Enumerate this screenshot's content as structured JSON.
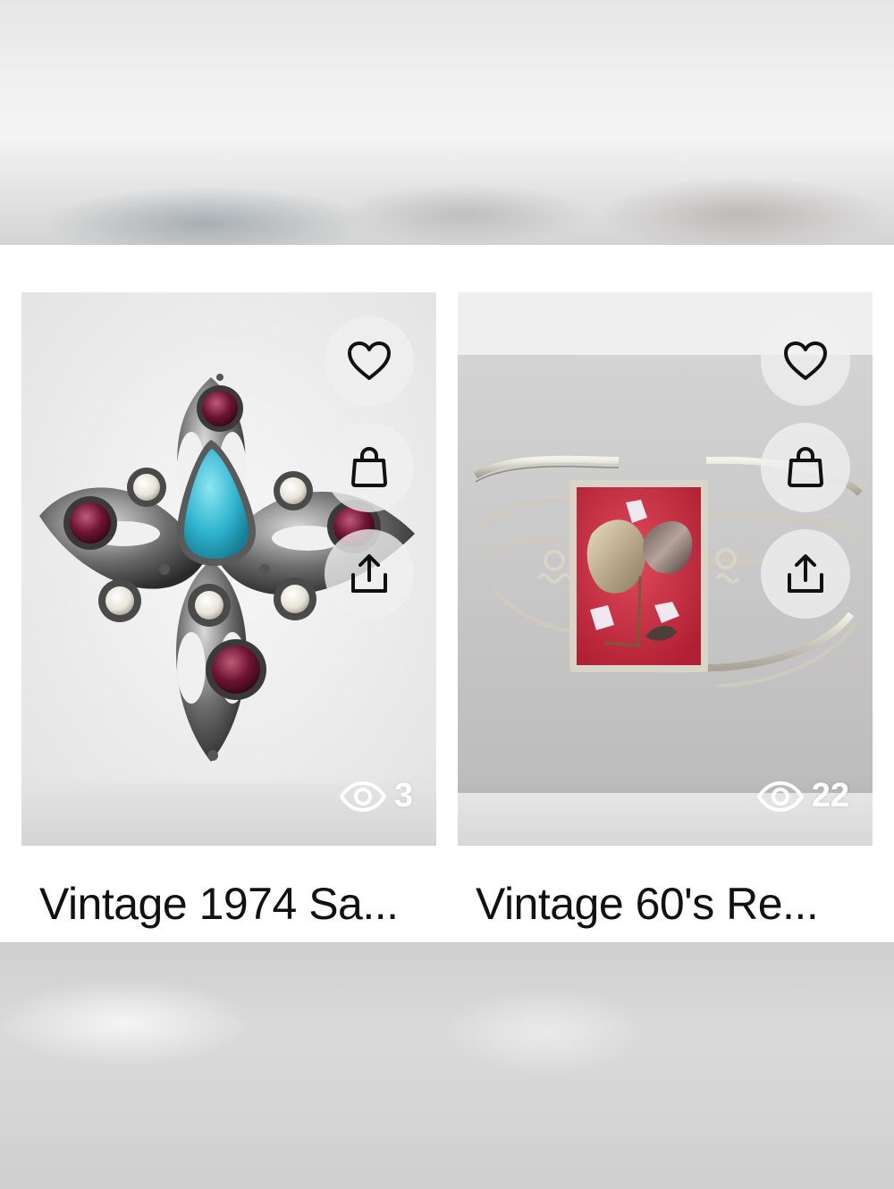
{
  "products": [
    {
      "title": "Vintage 1974 Sa...",
      "views": "3",
      "image": "brooch-image"
    },
    {
      "title": "Vintage 60's Re...",
      "views": "22",
      "image": "bracelet-image"
    }
  ],
  "icons": {
    "favorite": "heart-icon",
    "cart": "shopping-bag-icon",
    "share": "share-icon",
    "views": "eye-icon"
  },
  "colors": {
    "panel_background": "#ffffff",
    "card_background": "#efefef",
    "text": "#111111",
    "button_background": "#f0f0f0"
  }
}
